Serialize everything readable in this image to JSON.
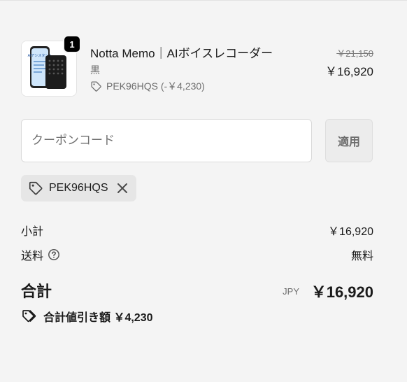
{
  "product": {
    "quantity": "1",
    "name": "Notta Memo｜AIボイスレコーダー",
    "variant": "黒",
    "discount_line": "PEK96HQS (-￥4,230)",
    "price_original": "￥21,150",
    "price_final": "￥16,920",
    "thumbnail_text": "AIアシスタント"
  },
  "coupon": {
    "placeholder": "クーポンコード",
    "value": "",
    "apply_label": "適用",
    "applied_code": "PEK96HQS"
  },
  "summary": {
    "subtotal_label": "小計",
    "subtotal_value": "￥16,920",
    "shipping_label": "送料",
    "shipping_value": "無料",
    "total_label": "合計",
    "total_currency": "JPY",
    "total_value": "￥16,920",
    "savings_text": "合計値引き額 ￥4,230"
  },
  "colors": {
    "background": "#f4f4f4",
    "chip": "#e6e6e6",
    "badge": "#000000",
    "device": "#1c1c1c",
    "screen": "#3a7bd5"
  }
}
